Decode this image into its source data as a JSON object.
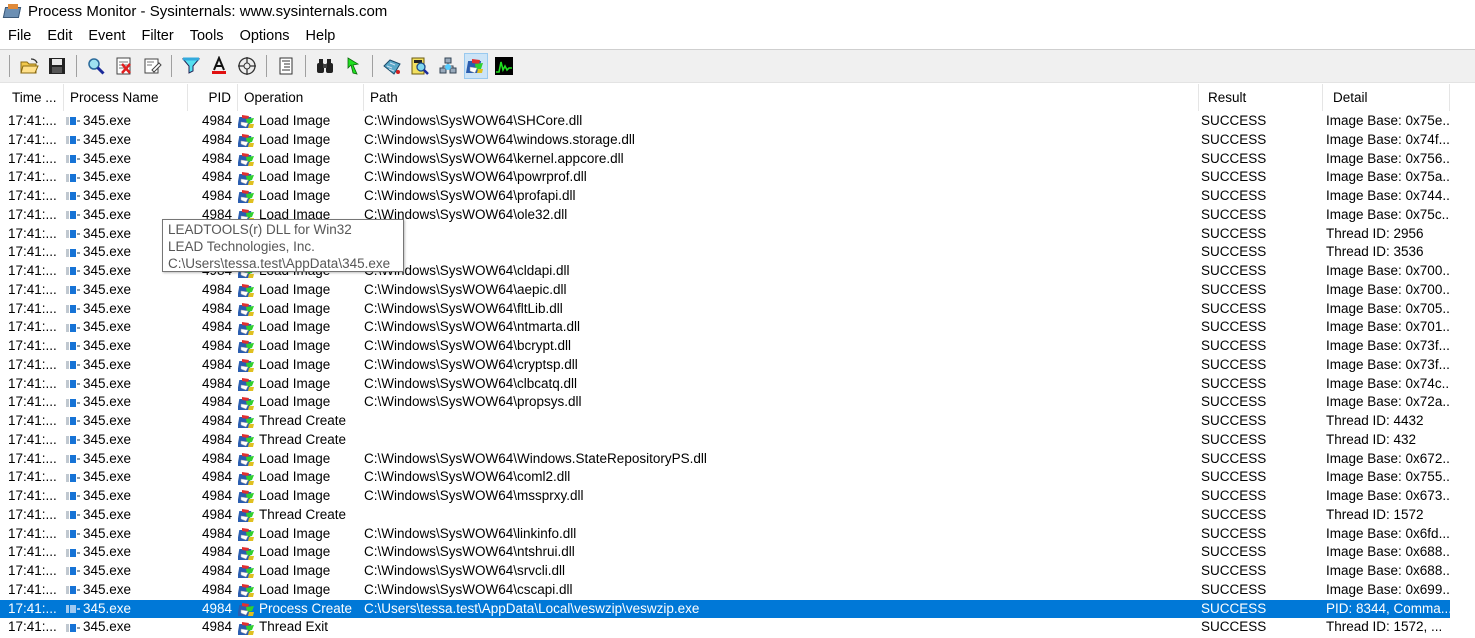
{
  "window": {
    "title": "Process Monitor - Sysinternals: www.sysinternals.com"
  },
  "menu": [
    "File",
    "Edit",
    "Event",
    "Filter",
    "Tools",
    "Options",
    "Help"
  ],
  "toolbar": {
    "buttons": [
      {
        "name": "open-icon",
        "label": "Open"
      },
      {
        "name": "save-icon",
        "label": "Save"
      },
      {
        "name": "capture-icon",
        "label": "Capture"
      },
      {
        "name": "autoscroll-icon",
        "label": "Autoscroll"
      },
      {
        "name": "clear-icon",
        "label": "Clear"
      },
      {
        "name": "filter-icon",
        "label": "Filter"
      },
      {
        "name": "highlight-icon",
        "label": "Highlight"
      },
      {
        "name": "include-process-icon",
        "label": "Include Process From Window"
      },
      {
        "name": "process-tree-icon",
        "label": "Process Tree"
      },
      {
        "name": "find-icon",
        "label": "Find"
      },
      {
        "name": "jump-to-icon",
        "label": "Jump To"
      },
      {
        "name": "show-registry-icon",
        "label": "Show Registry Activity"
      },
      {
        "name": "show-filesystem-icon",
        "label": "Show File System Activity"
      },
      {
        "name": "show-network-icon",
        "label": "Show Network Activity"
      },
      {
        "name": "show-process-thread-icon",
        "label": "Show Process and Thread Activity",
        "active": true
      },
      {
        "name": "show-profiling-icon",
        "label": "Show Profiling Events"
      }
    ]
  },
  "columns": {
    "time": "Time ...",
    "process": "Process Name",
    "pid": "PID",
    "operation": "Operation",
    "path": "Path",
    "result": "Result",
    "detail": "Detail"
  },
  "rows": [
    {
      "time": "17:41:...",
      "process": "345.exe",
      "pid": "4984",
      "operation": "Load Image",
      "path": "C:\\Windows\\SysWOW64\\SHCore.dll",
      "result": "SUCCESS",
      "detail": "Image Base: 0x75e..."
    },
    {
      "time": "17:41:...",
      "process": "345.exe",
      "pid": "4984",
      "operation": "Load Image",
      "path": "C:\\Windows\\SysWOW64\\windows.storage.dll",
      "result": "SUCCESS",
      "detail": "Image Base: 0x74f..."
    },
    {
      "time": "17:41:...",
      "process": "345.exe",
      "pid": "4984",
      "operation": "Load Image",
      "path": "C:\\Windows\\SysWOW64\\kernel.appcore.dll",
      "result": "SUCCESS",
      "detail": "Image Base: 0x756..."
    },
    {
      "time": "17:41:...",
      "process": "345.exe",
      "pid": "4984",
      "operation": "Load Image",
      "path": "C:\\Windows\\SysWOW64\\powrprof.dll",
      "result": "SUCCESS",
      "detail": "Image Base: 0x75a..."
    },
    {
      "time": "17:41:...",
      "process": "345.exe",
      "pid": "4984",
      "operation": "Load Image",
      "path": "C:\\Windows\\SysWOW64\\profapi.dll",
      "result": "SUCCESS",
      "detail": "Image Base: 0x744..."
    },
    {
      "time": "17:41:...",
      "process": "345.exe",
      "pid": "4984",
      "operation": "Load Image",
      "path": "C:\\Windows\\SysWOW64\\ole32.dll",
      "result": "SUCCESS",
      "detail": "Image Base: 0x75c..."
    },
    {
      "time": "17:41:...",
      "process": "345.exe",
      "pid": "",
      "operation": "",
      "path": "",
      "result": "SUCCESS",
      "detail": "Thread ID: 2956"
    },
    {
      "time": "17:41:...",
      "process": "345.exe",
      "pid": "",
      "operation": "",
      "path": "",
      "result": "SUCCESS",
      "detail": "Thread ID: 3536"
    },
    {
      "time": "17:41:...",
      "process": "345.exe",
      "pid": "4984",
      "operation": "Load Image",
      "path": "C:\\Windows\\SysWOW64\\cldapi.dll",
      "result": "SUCCESS",
      "detail": "Image Base: 0x700..."
    },
    {
      "time": "17:41:...",
      "process": "345.exe",
      "pid": "4984",
      "operation": "Load Image",
      "path": "C:\\Windows\\SysWOW64\\aepic.dll",
      "result": "SUCCESS",
      "detail": "Image Base: 0x700..."
    },
    {
      "time": "17:41:...",
      "process": "345.exe",
      "pid": "4984",
      "operation": "Load Image",
      "path": "C:\\Windows\\SysWOW64\\fltLib.dll",
      "result": "SUCCESS",
      "detail": "Image Base: 0x705..."
    },
    {
      "time": "17:41:...",
      "process": "345.exe",
      "pid": "4984",
      "operation": "Load Image",
      "path": "C:\\Windows\\SysWOW64\\ntmarta.dll",
      "result": "SUCCESS",
      "detail": "Image Base: 0x701..."
    },
    {
      "time": "17:41:...",
      "process": "345.exe",
      "pid": "4984",
      "operation": "Load Image",
      "path": "C:\\Windows\\SysWOW64\\bcrypt.dll",
      "result": "SUCCESS",
      "detail": "Image Base: 0x73f..."
    },
    {
      "time": "17:41:...",
      "process": "345.exe",
      "pid": "4984",
      "operation": "Load Image",
      "path": "C:\\Windows\\SysWOW64\\cryptsp.dll",
      "result": "SUCCESS",
      "detail": "Image Base: 0x73f..."
    },
    {
      "time": "17:41:...",
      "process": "345.exe",
      "pid": "4984",
      "operation": "Load Image",
      "path": "C:\\Windows\\SysWOW64\\clbcatq.dll",
      "result": "SUCCESS",
      "detail": "Image Base: 0x74c..."
    },
    {
      "time": "17:41:...",
      "process": "345.exe",
      "pid": "4984",
      "operation": "Load Image",
      "path": "C:\\Windows\\SysWOW64\\propsys.dll",
      "result": "SUCCESS",
      "detail": "Image Base: 0x72a..."
    },
    {
      "time": "17:41:...",
      "process": "345.exe",
      "pid": "4984",
      "operation": "Thread Create",
      "path": "",
      "result": "SUCCESS",
      "detail": "Thread ID: 4432"
    },
    {
      "time": "17:41:...",
      "process": "345.exe",
      "pid": "4984",
      "operation": "Thread Create",
      "path": "",
      "result": "SUCCESS",
      "detail": "Thread ID: 432"
    },
    {
      "time": "17:41:...",
      "process": "345.exe",
      "pid": "4984",
      "operation": "Load Image",
      "path": "C:\\Windows\\SysWOW64\\Windows.StateRepositoryPS.dll",
      "result": "SUCCESS",
      "detail": "Image Base: 0x672..."
    },
    {
      "time": "17:41:...",
      "process": "345.exe",
      "pid": "4984",
      "operation": "Load Image",
      "path": "C:\\Windows\\SysWOW64\\coml2.dll",
      "result": "SUCCESS",
      "detail": "Image Base: 0x755..."
    },
    {
      "time": "17:41:...",
      "process": "345.exe",
      "pid": "4984",
      "operation": "Load Image",
      "path": "C:\\Windows\\SysWOW64\\mssprxy.dll",
      "result": "SUCCESS",
      "detail": "Image Base: 0x673..."
    },
    {
      "time": "17:41:...",
      "process": "345.exe",
      "pid": "4984",
      "operation": "Thread Create",
      "path": "",
      "result": "SUCCESS",
      "detail": "Thread ID: 1572"
    },
    {
      "time": "17:41:...",
      "process": "345.exe",
      "pid": "4984",
      "operation": "Load Image",
      "path": "C:\\Windows\\SysWOW64\\linkinfo.dll",
      "result": "SUCCESS",
      "detail": "Image Base: 0x6fd..."
    },
    {
      "time": "17:41:...",
      "process": "345.exe",
      "pid": "4984",
      "operation": "Load Image",
      "path": "C:\\Windows\\SysWOW64\\ntshrui.dll",
      "result": "SUCCESS",
      "detail": "Image Base: 0x688..."
    },
    {
      "time": "17:41:...",
      "process": "345.exe",
      "pid": "4984",
      "operation": "Load Image",
      "path": "C:\\Windows\\SysWOW64\\srvcli.dll",
      "result": "SUCCESS",
      "detail": "Image Base: 0x688..."
    },
    {
      "time": "17:41:...",
      "process": "345.exe",
      "pid": "4984",
      "operation": "Load Image",
      "path": "C:\\Windows\\SysWOW64\\cscapi.dll",
      "result": "SUCCESS",
      "detail": "Image Base: 0x699..."
    },
    {
      "time": "17:41:...",
      "process": "345.exe",
      "pid": "4984",
      "operation": "Process Create",
      "path": "C:\\Users\\tessa.test\\AppData\\Local\\veswzip\\veswzip.exe",
      "result": "SUCCESS",
      "detail": "PID: 8344, Comma...",
      "selected": true
    },
    {
      "time": "17:41:...",
      "process": "345.exe",
      "pid": "4984",
      "operation": "Thread Exit",
      "path": "",
      "result": "SUCCESS",
      "detail": "Thread ID: 1572, ..."
    }
  ],
  "tooltip": {
    "lines": [
      "LEADTOOLS(r) DLL for Win32",
      "LEAD Technologies, Inc.",
      "C:\\Users\\tessa.test\\AppData\\345.exe"
    ]
  }
}
